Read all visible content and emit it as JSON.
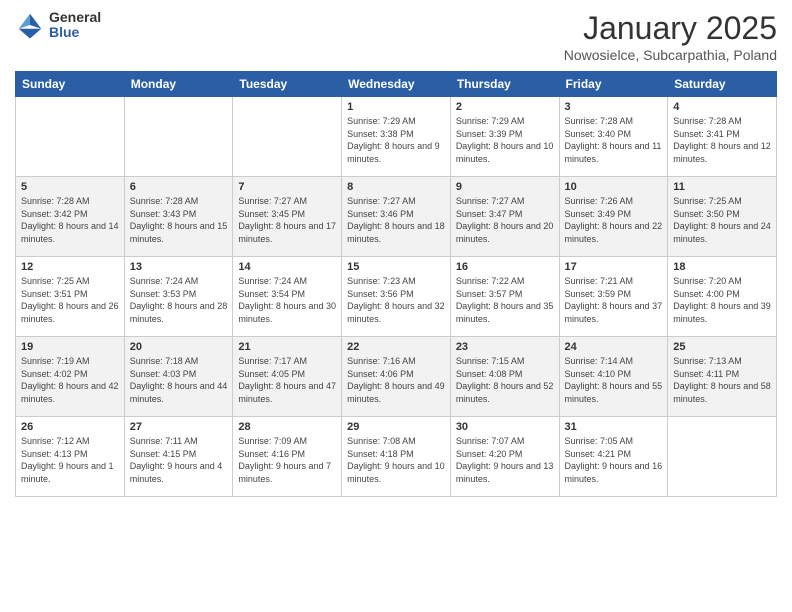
{
  "logo": {
    "general": "General",
    "blue": "Blue"
  },
  "title": {
    "month": "January 2025",
    "location": "Nowosielce, Subcarpathia, Poland"
  },
  "days": [
    "Sunday",
    "Monday",
    "Tuesday",
    "Wednesday",
    "Thursday",
    "Friday",
    "Saturday"
  ],
  "weeks": [
    [
      {
        "date": "",
        "sunrise": "",
        "sunset": "",
        "daylight": ""
      },
      {
        "date": "",
        "sunrise": "",
        "sunset": "",
        "daylight": ""
      },
      {
        "date": "",
        "sunrise": "",
        "sunset": "",
        "daylight": ""
      },
      {
        "date": "1",
        "sunrise": "Sunrise: 7:29 AM",
        "sunset": "Sunset: 3:38 PM",
        "daylight": "Daylight: 8 hours and 9 minutes."
      },
      {
        "date": "2",
        "sunrise": "Sunrise: 7:29 AM",
        "sunset": "Sunset: 3:39 PM",
        "daylight": "Daylight: 8 hours and 10 minutes."
      },
      {
        "date": "3",
        "sunrise": "Sunrise: 7:28 AM",
        "sunset": "Sunset: 3:40 PM",
        "daylight": "Daylight: 8 hours and 11 minutes."
      },
      {
        "date": "4",
        "sunrise": "Sunrise: 7:28 AM",
        "sunset": "Sunset: 3:41 PM",
        "daylight": "Daylight: 8 hours and 12 minutes."
      }
    ],
    [
      {
        "date": "5",
        "sunrise": "Sunrise: 7:28 AM",
        "sunset": "Sunset: 3:42 PM",
        "daylight": "Daylight: 8 hours and 14 minutes."
      },
      {
        "date": "6",
        "sunrise": "Sunrise: 7:28 AM",
        "sunset": "Sunset: 3:43 PM",
        "daylight": "Daylight: 8 hours and 15 minutes."
      },
      {
        "date": "7",
        "sunrise": "Sunrise: 7:27 AM",
        "sunset": "Sunset: 3:45 PM",
        "daylight": "Daylight: 8 hours and 17 minutes."
      },
      {
        "date": "8",
        "sunrise": "Sunrise: 7:27 AM",
        "sunset": "Sunset: 3:46 PM",
        "daylight": "Daylight: 8 hours and 18 minutes."
      },
      {
        "date": "9",
        "sunrise": "Sunrise: 7:27 AM",
        "sunset": "Sunset: 3:47 PM",
        "daylight": "Daylight: 8 hours and 20 minutes."
      },
      {
        "date": "10",
        "sunrise": "Sunrise: 7:26 AM",
        "sunset": "Sunset: 3:49 PM",
        "daylight": "Daylight: 8 hours and 22 minutes."
      },
      {
        "date": "11",
        "sunrise": "Sunrise: 7:25 AM",
        "sunset": "Sunset: 3:50 PM",
        "daylight": "Daylight: 8 hours and 24 minutes."
      }
    ],
    [
      {
        "date": "12",
        "sunrise": "Sunrise: 7:25 AM",
        "sunset": "Sunset: 3:51 PM",
        "daylight": "Daylight: 8 hours and 26 minutes."
      },
      {
        "date": "13",
        "sunrise": "Sunrise: 7:24 AM",
        "sunset": "Sunset: 3:53 PM",
        "daylight": "Daylight: 8 hours and 28 minutes."
      },
      {
        "date": "14",
        "sunrise": "Sunrise: 7:24 AM",
        "sunset": "Sunset: 3:54 PM",
        "daylight": "Daylight: 8 hours and 30 minutes."
      },
      {
        "date": "15",
        "sunrise": "Sunrise: 7:23 AM",
        "sunset": "Sunset: 3:56 PM",
        "daylight": "Daylight: 8 hours and 32 minutes."
      },
      {
        "date": "16",
        "sunrise": "Sunrise: 7:22 AM",
        "sunset": "Sunset: 3:57 PM",
        "daylight": "Daylight: 8 hours and 35 minutes."
      },
      {
        "date": "17",
        "sunrise": "Sunrise: 7:21 AM",
        "sunset": "Sunset: 3:59 PM",
        "daylight": "Daylight: 8 hours and 37 minutes."
      },
      {
        "date": "18",
        "sunrise": "Sunrise: 7:20 AM",
        "sunset": "Sunset: 4:00 PM",
        "daylight": "Daylight: 8 hours and 39 minutes."
      }
    ],
    [
      {
        "date": "19",
        "sunrise": "Sunrise: 7:19 AM",
        "sunset": "Sunset: 4:02 PM",
        "daylight": "Daylight: 8 hours and 42 minutes."
      },
      {
        "date": "20",
        "sunrise": "Sunrise: 7:18 AM",
        "sunset": "Sunset: 4:03 PM",
        "daylight": "Daylight: 8 hours and 44 minutes."
      },
      {
        "date": "21",
        "sunrise": "Sunrise: 7:17 AM",
        "sunset": "Sunset: 4:05 PM",
        "daylight": "Daylight: 8 hours and 47 minutes."
      },
      {
        "date": "22",
        "sunrise": "Sunrise: 7:16 AM",
        "sunset": "Sunset: 4:06 PM",
        "daylight": "Daylight: 8 hours and 49 minutes."
      },
      {
        "date": "23",
        "sunrise": "Sunrise: 7:15 AM",
        "sunset": "Sunset: 4:08 PM",
        "daylight": "Daylight: 8 hours and 52 minutes."
      },
      {
        "date": "24",
        "sunrise": "Sunrise: 7:14 AM",
        "sunset": "Sunset: 4:10 PM",
        "daylight": "Daylight: 8 hours and 55 minutes."
      },
      {
        "date": "25",
        "sunrise": "Sunrise: 7:13 AM",
        "sunset": "Sunset: 4:11 PM",
        "daylight": "Daylight: 8 hours and 58 minutes."
      }
    ],
    [
      {
        "date": "26",
        "sunrise": "Sunrise: 7:12 AM",
        "sunset": "Sunset: 4:13 PM",
        "daylight": "Daylight: 9 hours and 1 minute."
      },
      {
        "date": "27",
        "sunrise": "Sunrise: 7:11 AM",
        "sunset": "Sunset: 4:15 PM",
        "daylight": "Daylight: 9 hours and 4 minutes."
      },
      {
        "date": "28",
        "sunrise": "Sunrise: 7:09 AM",
        "sunset": "Sunset: 4:16 PM",
        "daylight": "Daylight: 9 hours and 7 minutes."
      },
      {
        "date": "29",
        "sunrise": "Sunrise: 7:08 AM",
        "sunset": "Sunset: 4:18 PM",
        "daylight": "Daylight: 9 hours and 10 minutes."
      },
      {
        "date": "30",
        "sunrise": "Sunrise: 7:07 AM",
        "sunset": "Sunset: 4:20 PM",
        "daylight": "Daylight: 9 hours and 13 minutes."
      },
      {
        "date": "31",
        "sunrise": "Sunrise: 7:05 AM",
        "sunset": "Sunset: 4:21 PM",
        "daylight": "Daylight: 9 hours and 16 minutes."
      },
      {
        "date": "",
        "sunrise": "",
        "sunset": "",
        "daylight": ""
      }
    ]
  ]
}
